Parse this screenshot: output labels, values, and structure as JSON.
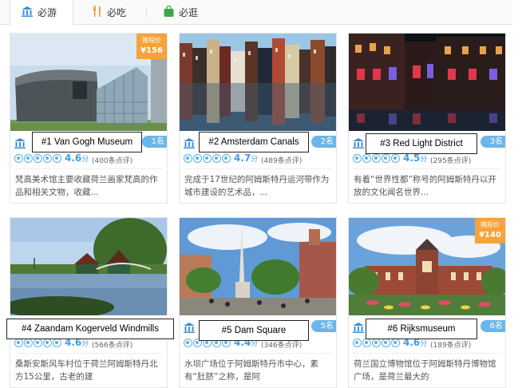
{
  "tabs": [
    {
      "label": "必游",
      "icon": "museum-icon",
      "active": true
    },
    {
      "label": "必吃",
      "icon": "fork-knife-icon",
      "active": false
    },
    {
      "label": "必逛",
      "icon": "shopping-bag-icon",
      "active": false
    }
  ],
  "cards": [
    {
      "caption": "#1 Van Gogh Museum",
      "rank_badge": "1名",
      "score": "4.6",
      "score_unit": "分",
      "reviews": "(400条点评)",
      "desc": "梵高美术馆主要收藏荷兰画家梵高的作品和相关文物，收藏...",
      "price_label": "携程价",
      "price": "¥156"
    },
    {
      "caption": "#2 Amsterdam Canals",
      "rank_badge": "2名",
      "score": "4.7",
      "score_unit": "分",
      "reviews": "(489条点评)",
      "desc": "完成于17世纪的阿姆斯特丹运河带作为城市建设的艺术品，..."
    },
    {
      "caption": "#3 Red Light District",
      "rank_badge": "3名",
      "score": "4.5",
      "score_unit": "分",
      "reviews": "(295条点评)",
      "desc": "有着“世界性都”称号的阿姆斯特丹以开放的文化闻名世界..."
    },
    {
      "caption": "#4 Zaandam Kogerveld Windmills",
      "rank_badge": "",
      "score": "4.6",
      "score_unit": "分",
      "reviews": "(566条点评)",
      "desc": "桑斯安斯风车村位于荷兰阿姆斯特丹北方15公里，古老的建"
    },
    {
      "caption": "#5 Dam Square",
      "rank_badge": "5名",
      "score": "4.4",
      "score_unit": "分",
      "reviews": "(346条点评)",
      "desc": "水坝广场位于阿姆斯特丹市中心，素有“肚脐”之称，是阿"
    },
    {
      "caption": "#6 Rijksmuseum",
      "rank_badge": "6名",
      "score": "4.6",
      "score_unit": "分",
      "reviews": "(189条点评)",
      "desc": "荷兰国立博物馆位于阿姆斯特丹博物馆广场，是荷兰最大的",
      "price_label": "携程价",
      "price": "¥140"
    }
  ],
  "colors": {
    "accent": "#3d9fe0",
    "badge": "#6cb5e8",
    "price": "#f7a23a"
  }
}
